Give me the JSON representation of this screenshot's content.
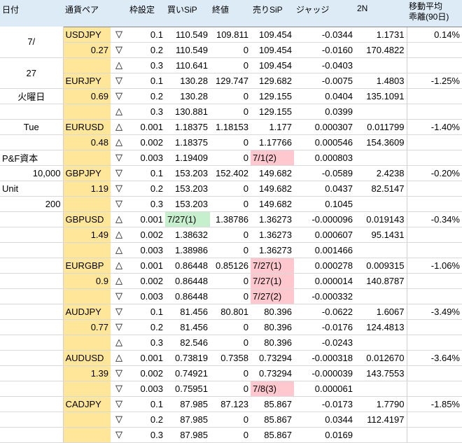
{
  "headers": [
    "日付",
    "通貨ペア",
    "",
    "枠設定",
    "買いSiP",
    "終値",
    "売りSiP",
    "ジャッジ",
    "2N",
    "移動平均\n乖離(90日)"
  ],
  "side": {
    "date_month": "7/",
    "date_day": "27",
    "weekday_jp": "火曜日",
    "weekday_en": "Tue",
    "pf_label": "P&F資本",
    "pf_value": "10,000",
    "unit_label": "Unit",
    "unit_value": "200"
  },
  "pairs": [
    {
      "name": "USDJPY",
      "val": "0.27",
      "dev": "0.14%",
      "rows": [
        {
          "sym": "▽",
          "frame": "0.1",
          "buy": "110.549",
          "close": "109.811",
          "sell": "109.454",
          "judge": "-0.0344",
          "n2": "1.1731"
        },
        {
          "sym": "▽",
          "frame": "0.2",
          "buy": "110.549",
          "close": "0",
          "sell": "109.454",
          "judge": "-0.0160",
          "n2": "170.4822"
        },
        {
          "sym": "△",
          "frame": "0.3",
          "buy": "110.641",
          "close": "0",
          "sell": "109.454",
          "judge": "-0.0403",
          "n2": ""
        }
      ]
    },
    {
      "name": "EURJPY",
      "val": "0.69",
      "dev": "-1.25%",
      "rows": [
        {
          "sym": "▽",
          "frame": "0.1",
          "buy": "130.28",
          "close": "129.747",
          "sell": "129.682",
          "judge": "-0.0075",
          "n2": "1.4803"
        },
        {
          "sym": "▽",
          "frame": "0.2",
          "buy": "130.28",
          "close": "0",
          "sell": "129.155",
          "judge": "0.0404",
          "n2": "135.1091"
        },
        {
          "sym": "△",
          "frame": "0.3",
          "buy": "130.881",
          "close": "0",
          "sell": "129.155",
          "judge": "0.0399",
          "n2": ""
        }
      ]
    },
    {
      "name": "EURUSD",
      "val": "0.48",
      "dev": "-1.40%",
      "rows": [
        {
          "sym": "△",
          "frame": "0.001",
          "buy": "1.18375",
          "close": "1.18153",
          "sell": "1.177",
          "judge": "0.000307",
          "n2": "0.011799"
        },
        {
          "sym": "△",
          "frame": "0.002",
          "buy": "1.18375",
          "close": "0",
          "sell": "1.17766",
          "judge": "0.000546",
          "n2": "154.3609"
        },
        {
          "sym": "▽",
          "frame": "0.003",
          "buy": "1.19409",
          "close": "0",
          "sell": "7/1(2)",
          "judge": "0.000803",
          "n2": ""
        }
      ]
    },
    {
      "name": "GBPJPY",
      "val": "1.19",
      "dev": "-0.20%",
      "rows": [
        {
          "sym": "▽",
          "frame": "0.1",
          "buy": "153.203",
          "close": "152.402",
          "sell": "149.682",
          "judge": "-0.0589",
          "n2": "2.4238"
        },
        {
          "sym": "▽",
          "frame": "0.2",
          "buy": "153.203",
          "close": "0",
          "sell": "149.682",
          "judge": "0.0437",
          "n2": "82.5147"
        },
        {
          "sym": "▽",
          "frame": "0.3",
          "buy": "153.203",
          "close": "0",
          "sell": "149.682",
          "judge": "0.1045",
          "n2": ""
        }
      ]
    },
    {
      "name": "GBPUSD",
      "val": "1.49",
      "dev": "-0.34%",
      "rows": [
        {
          "sym": "△",
          "frame": "0.001",
          "buy": "7/27(1)",
          "close": "1.38786",
          "sell": "1.36273",
          "judge": "-0.000096",
          "n2": "0.019143"
        },
        {
          "sym": "△",
          "frame": "0.002",
          "buy": "1.38632",
          "close": "0",
          "sell": "1.36273",
          "judge": "0.000607",
          "n2": "95.1431"
        },
        {
          "sym": "△",
          "frame": "0.003",
          "buy": "1.38986",
          "close": "0",
          "sell": "1.36273",
          "judge": "0.001466",
          "n2": ""
        }
      ]
    },
    {
      "name": "EURGBP",
      "val": "0.9",
      "dev": "-1.06%",
      "rows": [
        {
          "sym": "△",
          "frame": "0.001",
          "buy": "0.86448",
          "close": "0.85126",
          "sell": "7/27(1)",
          "judge": "0.000278",
          "n2": "0.009315"
        },
        {
          "sym": "△",
          "frame": "0.002",
          "buy": "0.86448",
          "close": "0",
          "sell": "7/27(1)",
          "judge": "0.000014",
          "n2": "140.8787"
        },
        {
          "sym": "▽",
          "frame": "0.003",
          "buy": "0.86448",
          "close": "0",
          "sell": "7/27(2)",
          "judge": "-0.000332",
          "n2": ""
        }
      ]
    },
    {
      "name": "AUDJPY",
      "val": "0.77",
      "dev": "-3.49%",
      "rows": [
        {
          "sym": "▽",
          "frame": "0.1",
          "buy": "81.456",
          "close": "80.801",
          "sell": "80.396",
          "judge": "-0.0622",
          "n2": "1.6067"
        },
        {
          "sym": "▽",
          "frame": "0.2",
          "buy": "81.456",
          "close": "0",
          "sell": "80.396",
          "judge": "-0.0176",
          "n2": "124.4813"
        },
        {
          "sym": "△",
          "frame": "0.3",
          "buy": "82.546",
          "close": "0",
          "sell": "80.396",
          "judge": "-0.0243",
          "n2": ""
        }
      ]
    },
    {
      "name": "AUDUSD",
      "val": "1.39",
      "dev": "-3.64%",
      "rows": [
        {
          "sym": "△",
          "frame": "0.001",
          "buy": "0.73819",
          "close": "0.7358",
          "sell": "0.73294",
          "judge": "-0.000318",
          "n2": "0.012670"
        },
        {
          "sym": "▽",
          "frame": "0.002",
          "buy": "0.74921",
          "close": "0",
          "sell": "0.73294",
          "judge": "-0.000039",
          "n2": "143.7553"
        },
        {
          "sym": "▽",
          "frame": "0.003",
          "buy": "0.75951",
          "close": "0",
          "sell": "7/8(3)",
          "judge": "0.000061",
          "n2": ""
        }
      ]
    },
    {
      "name": "CADJPY",
      "val": "",
      "dev": "-1.85%",
      "rows": [
        {
          "sym": "▽",
          "frame": "0.1",
          "buy": "87.985",
          "close": "87.123",
          "sell": "85.867",
          "judge": "-0.0173",
          "n2": "1.7790"
        },
        {
          "sym": "▽",
          "frame": "0.2",
          "buy": "87.985",
          "close": "0",
          "sell": "85.867",
          "judge": "0.0344",
          "n2": "112.4197"
        },
        {
          "sym": "▽",
          "frame": "0.3",
          "buy": "87.985",
          "close": "0",
          "sell": "85.867",
          "judge": "0.0169",
          "n2": ""
        }
      ]
    }
  ],
  "colors": {
    "header_bg": "#ddebf7",
    "pair_bg": "#ffe699",
    "pink_bg": "#ffc7ce",
    "green_bg": "#c6efce",
    "neg_text": "#c00000"
  }
}
